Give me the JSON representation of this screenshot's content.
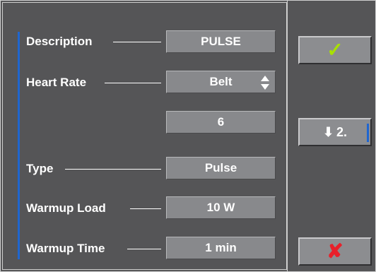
{
  "rows": [
    {
      "label": "Description",
      "value": "PULSE"
    },
    {
      "label": "Heart Rate",
      "value": "Belt"
    },
    {
      "label": "",
      "value": "6"
    },
    {
      "label": "Type",
      "value": "Pulse"
    },
    {
      "label": "Warmup Load",
      "value": "10 W"
    },
    {
      "label": "Warmup Time",
      "value": "1 min"
    }
  ],
  "buttons": {
    "confirm_icon": "check-icon",
    "confirm_glyph": "✓",
    "next_label": "2.",
    "next_glyph": "⬇",
    "cancel_icon": "cross-icon",
    "cancel_glyph": "✘"
  },
  "colors": {
    "accent": "#1f66d0",
    "check": "#a8e000",
    "cross": "#e8202a",
    "field": "#88898c",
    "background": "#555557"
  }
}
